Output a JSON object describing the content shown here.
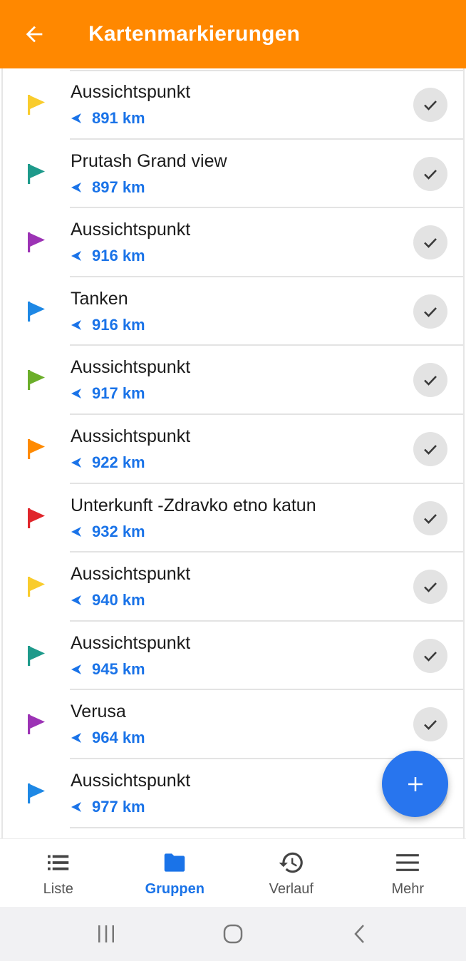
{
  "app_bar": {
    "title": "Kartenmarkierungen",
    "background": "#FF8800",
    "back_icon": "arrow-back-icon"
  },
  "markers": [
    {
      "name": "Aussichtspunkt",
      "distance": "891 km",
      "flag_color": "#F9CC2D"
    },
    {
      "name": "Prutash Grand view",
      "distance": "897 km",
      "flag_color": "#1E9A8B"
    },
    {
      "name": "Aussichtspunkt",
      "distance": "916 km",
      "flag_color": "#9C33B5"
    },
    {
      "name": "Tanken",
      "distance": "916 km",
      "flag_color": "#1E88E5"
    },
    {
      "name": "Aussichtspunkt",
      "distance": "917 km",
      "flag_color": "#6BAE2A"
    },
    {
      "name": "Aussichtspunkt",
      "distance": "922 km",
      "flag_color": "#FF8A00"
    },
    {
      "name": "Unterkunft -Zdravko etno katun",
      "distance": "932 km",
      "flag_color": "#E0262B"
    },
    {
      "name": "Aussichtspunkt",
      "distance": "940 km",
      "flag_color": "#F9CC2D"
    },
    {
      "name": "Aussichtspunkt",
      "distance": "945 km",
      "flag_color": "#1E9A8B"
    },
    {
      "name": "Verusa",
      "distance": "964 km",
      "flag_color": "#9C33B5"
    },
    {
      "name": "Aussichtspunkt",
      "distance": "977 km",
      "flag_color": "#1E88E5"
    }
  ],
  "colors": {
    "distance_text": "#1A73E8",
    "accent": "#2875EE",
    "check_bg": "#E3E3E3"
  },
  "fab": {
    "icon": "plus-icon"
  },
  "bottom_nav": {
    "items": [
      {
        "label": "Liste",
        "icon": "list-icon",
        "active": false
      },
      {
        "label": "Gruppen",
        "icon": "folder-icon",
        "active": true
      },
      {
        "label": "Verlauf",
        "icon": "history-icon",
        "active": false
      },
      {
        "label": "Mehr",
        "icon": "menu-icon",
        "active": false
      }
    ]
  },
  "system_nav": {
    "icons": [
      "recent-apps-icon",
      "home-icon",
      "back-icon"
    ]
  }
}
